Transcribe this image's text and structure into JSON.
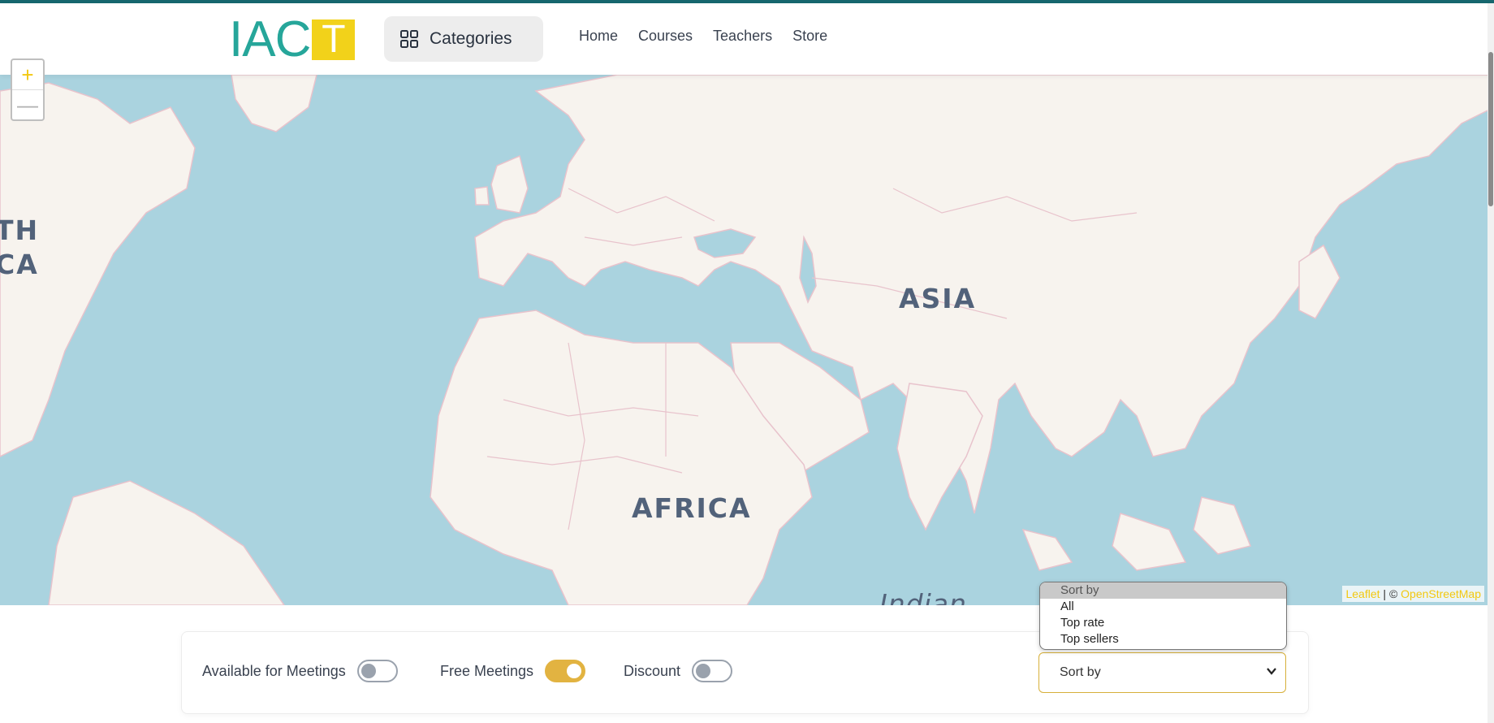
{
  "header": {
    "logo_text": "IAC",
    "logo_box_text": "T",
    "categories_label": "Categories",
    "nav": [
      "Home",
      "Courses",
      "Teachers",
      "Store"
    ]
  },
  "map": {
    "labels": {
      "north_america_a": "TH",
      "north_america_b": "CA",
      "asia": "ASIA",
      "africa": "AFRICA",
      "ocean": "Indian"
    },
    "zoom_in": "+",
    "zoom_out": "—",
    "attribution": {
      "leaflet": "Leaflet",
      "separator": " | © ",
      "osm": "OpenStreetMap"
    },
    "colors": {
      "water": "#aad3df",
      "land": "#f7f3ee",
      "border": "#e8c3cc"
    }
  },
  "filters": {
    "available_label": "Available for Meetings",
    "available_on": false,
    "free_label": "Free Meetings",
    "free_on": true,
    "discount_label": "Discount",
    "discount_on": false
  },
  "sort": {
    "selected": "Sort by",
    "options": [
      "Sort by",
      "All",
      "Top rate",
      "Top sellers"
    ]
  },
  "colors": {
    "accent": "#e2b341",
    "brand_teal": "#26a69a",
    "brand_yellow": "#f2d21a",
    "top_bar": "#16676e"
  }
}
